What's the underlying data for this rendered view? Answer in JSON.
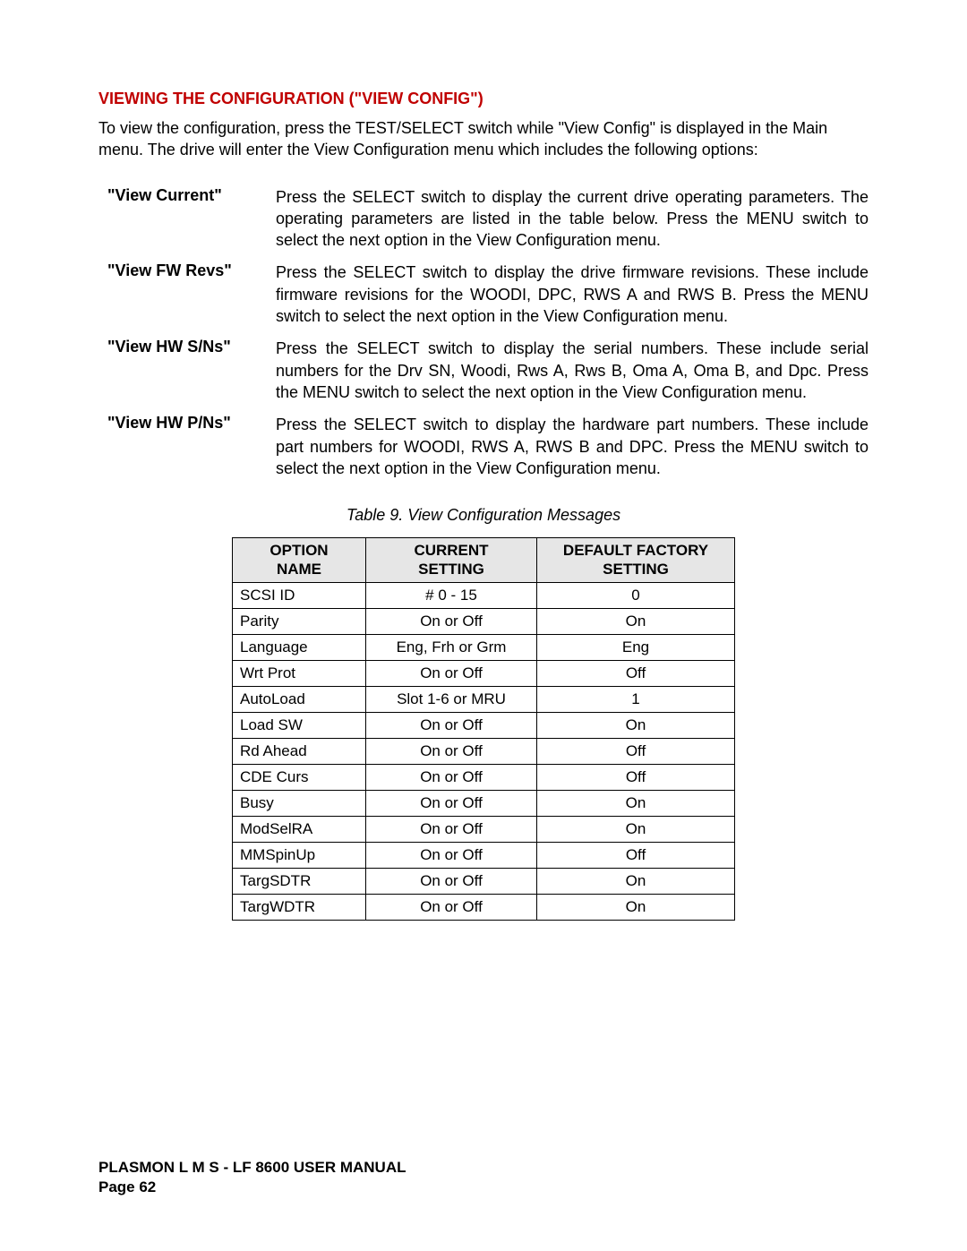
{
  "heading": "VIEWING THE CONFIGURATION (\"VIEW CONFIG\")",
  "intro": "To view the configuration, press the TEST/SELECT switch while \"View Config\" is displayed in the Main menu. The drive will enter the View Configuration menu which includes the following options:",
  "defs": [
    {
      "term": "\"View Current\"",
      "desc": "Press the SELECT switch to display the current drive operating parameters. The operating parameters are listed in the table below. Press the MENU switch to select the next option in the View Configuration menu."
    },
    {
      "term": "\"View FW Revs\"",
      "desc": "Press the SELECT switch to display the drive firmware revisions. These include firmware revisions for the WOODI, DPC, RWS A and RWS B. Press the MENU switch to select the next option in the View Configuration menu."
    },
    {
      "term": "\"View HW S/Ns\"",
      "desc": "Press the SELECT switch to display the serial numbers. These include serial numbers for the Drv SN, Woodi, Rws A, Rws B, Oma A, Oma B, and Dpc. Press the MENU switch to select the next option in the View Configuration menu."
    },
    {
      "term": "\"View HW P/Ns\"",
      "desc": "Press the SELECT switch to display the hardware part numbers. These include part numbers for WOODI, RWS A, RWS B and DPC. Press the MENU switch to select the next option in the View Configuration menu."
    }
  ],
  "table_caption": "Table 9. View Configuration Messages",
  "table": {
    "headers": {
      "c1a": "OPTION",
      "c1b": "NAME",
      "c2a": "CURRENT",
      "c2b": "SETTING",
      "c3a": "DEFAULT FACTORY",
      "c3b": "SETTING"
    },
    "rows": [
      {
        "name": "SCSI ID",
        "current": "# 0 - 15",
        "def": "0"
      },
      {
        "name": "Parity",
        "current": "On or Off",
        "def": "On"
      },
      {
        "name": "Language",
        "current": "Eng, Frh or Grm",
        "def": "Eng"
      },
      {
        "name": "Wrt Prot",
        "current": "On or Off",
        "def": "Off"
      },
      {
        "name": "AutoLoad",
        "current": "Slot 1-6 or MRU",
        "def": "1"
      },
      {
        "name": "Load SW",
        "current": "On or Off",
        "def": "On"
      },
      {
        "name": "Rd Ahead",
        "current": "On or Off",
        "def": "Off"
      },
      {
        "name": "CDE Curs",
        "current": "On or Off",
        "def": "Off"
      },
      {
        "name": "Busy",
        "current": "On or Off",
        "def": "On"
      },
      {
        "name": "ModSelRA",
        "current": "On or Off",
        "def": "On"
      },
      {
        "name": "MMSpinUp",
        "current": "On or Off",
        "def": "Off"
      },
      {
        "name": "TargSDTR",
        "current": "On or Off",
        "def": "On"
      },
      {
        "name": "TargWDTR",
        "current": "On or Off",
        "def": "On"
      }
    ]
  },
  "footer_line1": "PLASMON  L M S  -  LF 8600  USER MANUAL",
  "footer_line2": "Page 62"
}
